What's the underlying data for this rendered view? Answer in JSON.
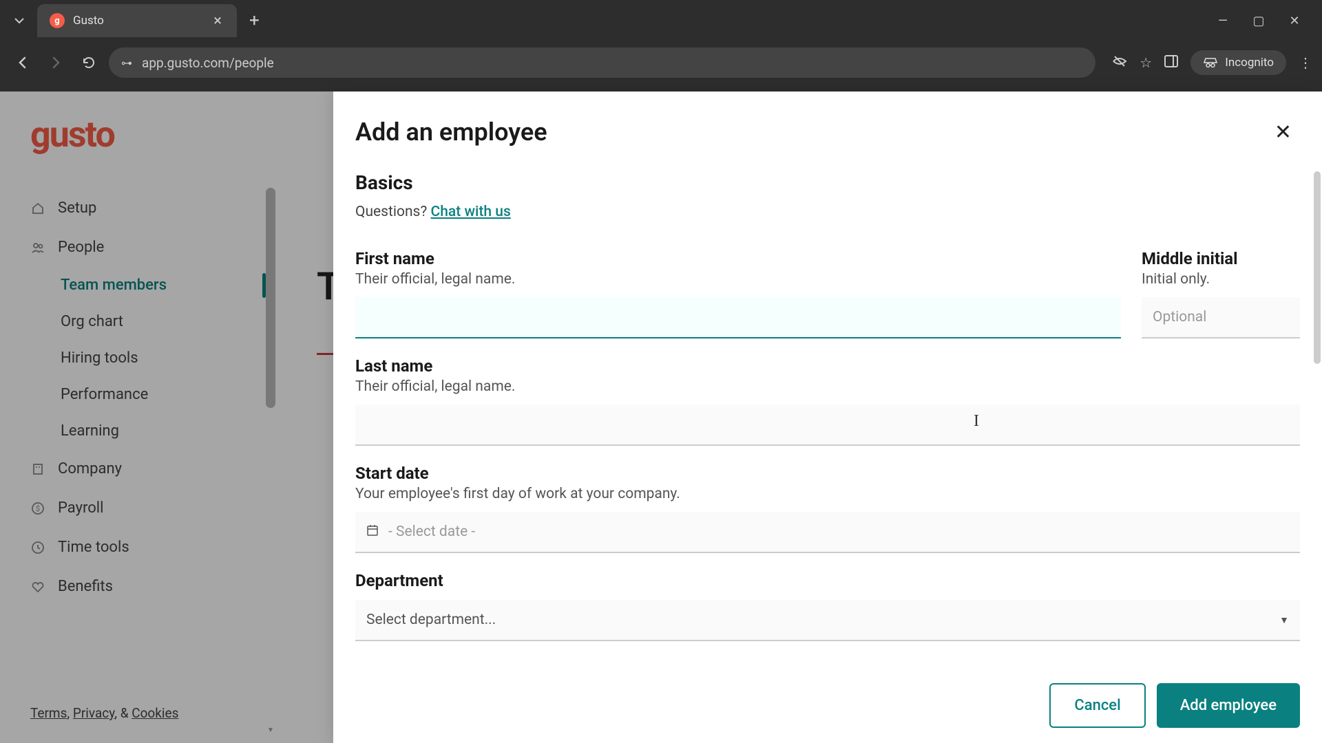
{
  "browser": {
    "tab_title": "Gusto",
    "url": "app.gusto.com/people",
    "incognito_label": "Incognito"
  },
  "sidebar": {
    "logo": "gusto",
    "items": [
      {
        "label": "Setup",
        "icon": "home"
      },
      {
        "label": "People",
        "icon": "users",
        "expanded": true
      },
      {
        "label": "Company",
        "icon": "building"
      },
      {
        "label": "Payroll",
        "icon": "dollar"
      },
      {
        "label": "Time tools",
        "icon": "clock"
      },
      {
        "label": "Benefits",
        "icon": "heart"
      }
    ],
    "people_sub": [
      {
        "label": "Team members",
        "active": true
      },
      {
        "label": "Org chart"
      },
      {
        "label": "Hiring tools"
      },
      {
        "label": "Performance"
      },
      {
        "label": "Learning"
      }
    ],
    "footer": {
      "terms": "Terms",
      "privacy": "Privacy",
      "sep1": ", ",
      "amp": ", & ",
      "cookies": "Cookies"
    }
  },
  "bg_page": {
    "heading_fragment": "T"
  },
  "modal": {
    "title": "Add an employee",
    "section": "Basics",
    "questions": "Questions? ",
    "chat_link": "Chat with us",
    "fields": {
      "first_name": {
        "label": "First name",
        "help": "Their official, legal name.",
        "value": ""
      },
      "middle_initial": {
        "label": "Middle initial",
        "help": "Initial only.",
        "placeholder": "Optional",
        "value": ""
      },
      "last_name": {
        "label": "Last name",
        "help": "Their official, legal name.",
        "value": ""
      },
      "start_date": {
        "label": "Start date",
        "help": "Your employee's first day of work at your company.",
        "placeholder": "- Select date -"
      },
      "department": {
        "label": "Department",
        "placeholder": "Select department..."
      }
    },
    "buttons": {
      "cancel": "Cancel",
      "submit": "Add employee"
    }
  }
}
